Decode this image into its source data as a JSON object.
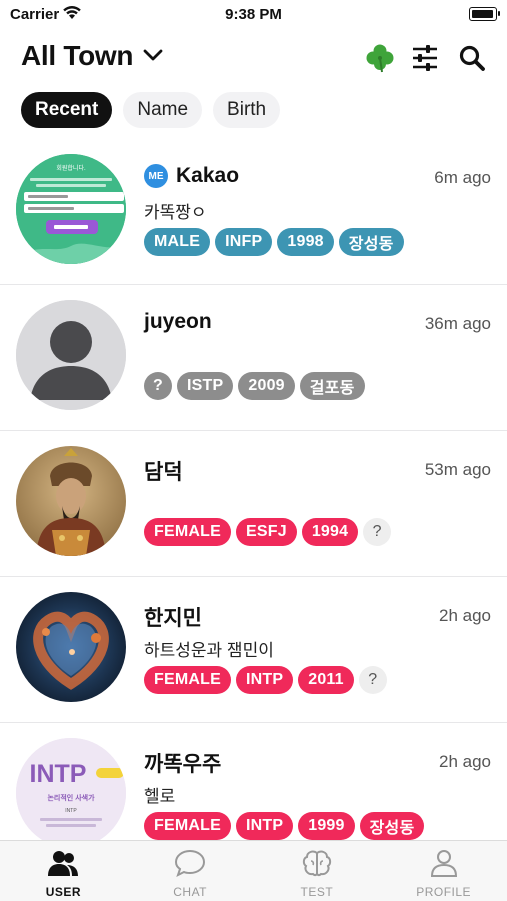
{
  "status_bar": {
    "carrier": "Carrier",
    "time": "9:38 PM"
  },
  "header": {
    "title": "All Town",
    "icons": [
      "clover-icon",
      "filter-sliders-icon",
      "search-icon"
    ]
  },
  "sort_options": [
    {
      "label": "Recent",
      "active": true
    },
    {
      "label": "Name",
      "active": false
    },
    {
      "label": "Birth",
      "active": false
    }
  ],
  "colors": {
    "male": "#3d95b3",
    "female": "#f0295a",
    "grey": "#8d8d8d",
    "me_badge": "#2f8fe0"
  },
  "users": [
    {
      "name": "Kakao",
      "me_badge": "ME",
      "time_ago": "6m ago",
      "message": "카똑짱ㅇ",
      "avatar": "form-screenshot",
      "tags": [
        "MALE",
        "INFP",
        "1998",
        "장성동"
      ],
      "tag_color": "male"
    },
    {
      "name": "juyeon",
      "time_ago": "36m ago",
      "message": "",
      "avatar": "default-person",
      "tags": [
        "?",
        "ISTP",
        "2009",
        "걸포동"
      ],
      "tag_color": "grey"
    },
    {
      "name": "담덕",
      "time_ago": "53m ago",
      "message": "",
      "avatar": "warrior-portrait",
      "tags": [
        "FEMALE",
        "ESFJ",
        "1994",
        "?"
      ],
      "tag_color": "female"
    },
    {
      "name": "한지민",
      "time_ago": "2h ago",
      "message": "하트성운과 잼민이",
      "avatar": "heart-nebula",
      "tags": [
        "FEMALE",
        "INTP",
        "2011",
        "?"
      ],
      "tag_color": "female"
    },
    {
      "name": "까똑우주",
      "time_ago": "2h ago",
      "message": "헬로",
      "avatar": "intp-card",
      "avatar_text": {
        "big": "INTP",
        "sub": "논리적인 사색가",
        "small": "INTP"
      },
      "tags": [
        "FEMALE",
        "INTP",
        "1999",
        "장성동"
      ],
      "tag_color": "female"
    }
  ],
  "form_avatar_text": "회원합니다.",
  "tabs": [
    {
      "label": "USER",
      "icon": "users-icon",
      "active": true
    },
    {
      "label": "CHAT",
      "icon": "chat-bubble-icon",
      "active": false
    },
    {
      "label": "TEST",
      "icon": "brain-icon",
      "active": false
    },
    {
      "label": "PROFILE",
      "icon": "person-icon",
      "active": false
    }
  ]
}
